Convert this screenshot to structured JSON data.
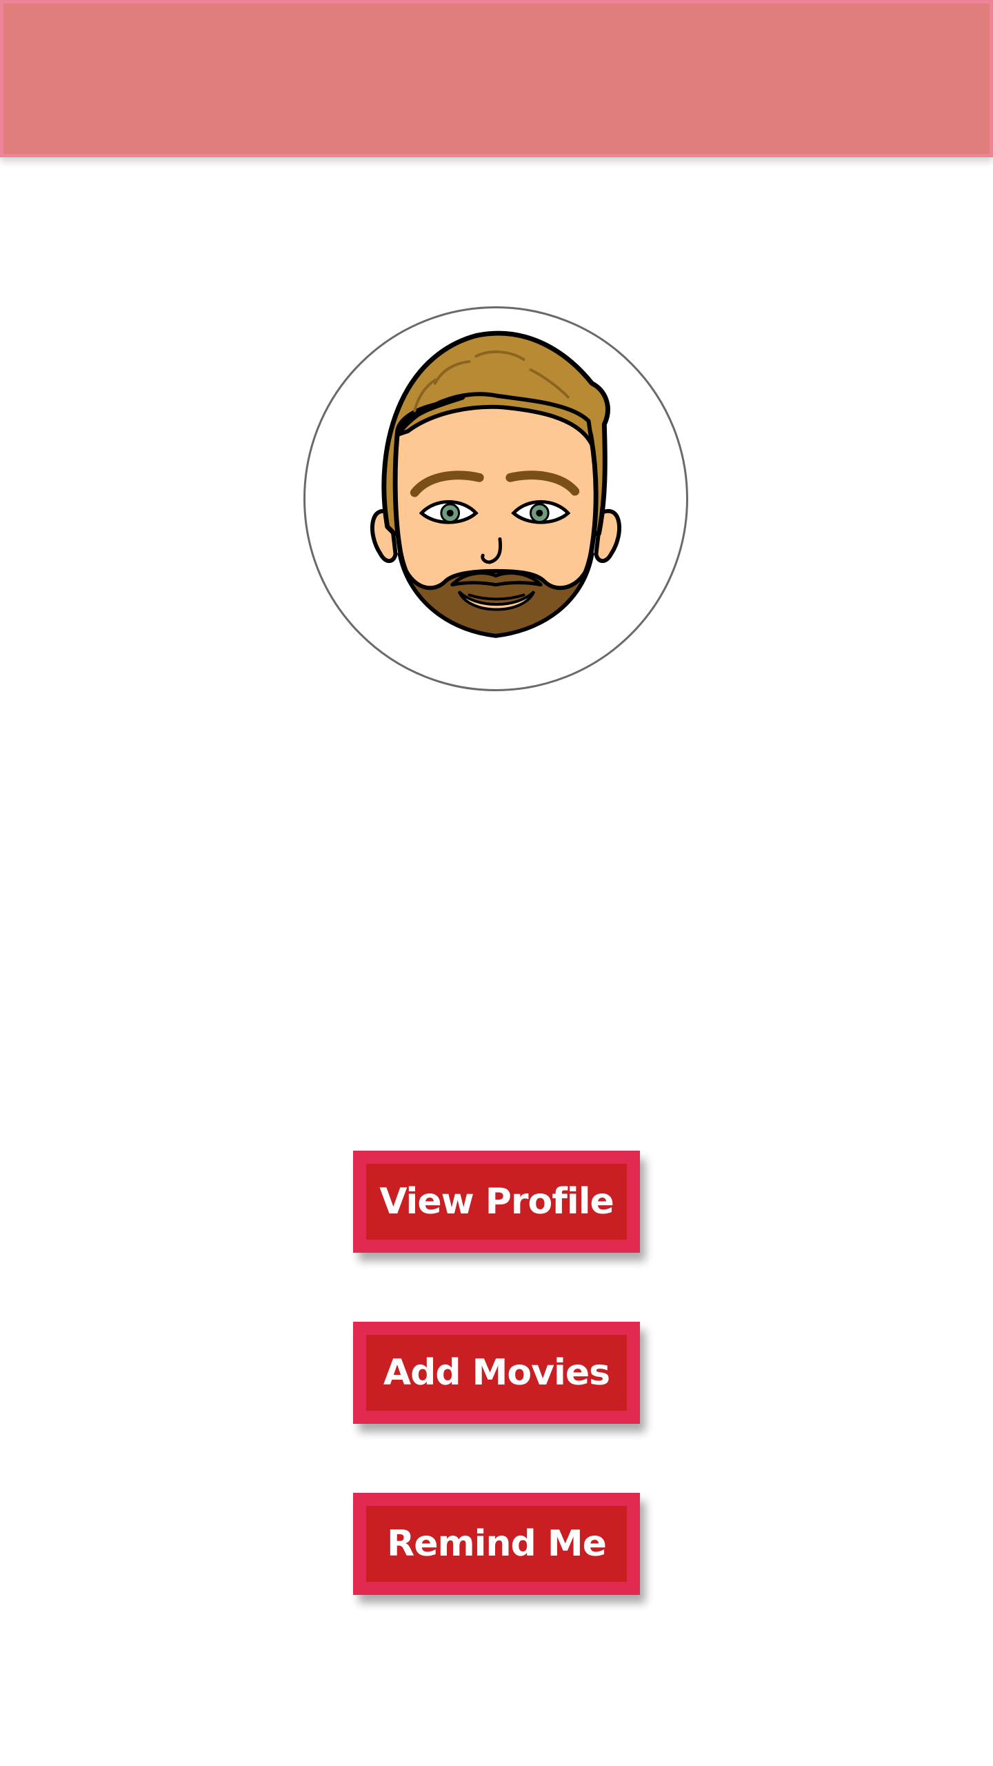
{
  "header": {
    "background_color": "#e07d7d",
    "border_color": "#ee8597"
  },
  "avatar": {
    "icon": "bearded-man-avatar-icon"
  },
  "actions": {
    "button_color": "#c91e22",
    "button_border_color": "#e2294f",
    "view_profile_label": "View Profile",
    "add_movies_label": "Add Movies",
    "remind_me_label": "Remind Me"
  }
}
